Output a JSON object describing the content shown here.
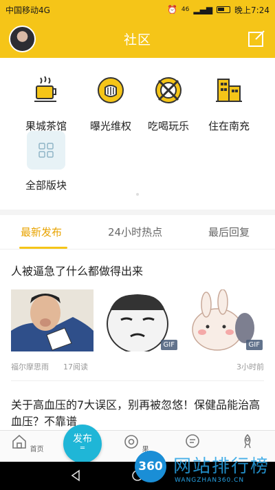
{
  "status_bar": {
    "carrier": "中国移动4G",
    "signal": "46",
    "time": "晚上7:24"
  },
  "header": {
    "title": "社区"
  },
  "categories": [
    {
      "label": "果城茶馆",
      "icon": "tea-cup-icon"
    },
    {
      "label": "曝光维权",
      "icon": "fist-icon"
    },
    {
      "label": "吃喝玩乐",
      "icon": "fork-knife-icon"
    },
    {
      "label": "住在南充",
      "icon": "building-icon"
    },
    {
      "label": "全部版块",
      "icon": "grid-icon"
    }
  ],
  "tabs": [
    {
      "label": "最新发布",
      "active": true
    },
    {
      "label": "24小时热点",
      "active": false
    },
    {
      "label": "最后回复",
      "active": false
    }
  ],
  "posts": [
    {
      "title": "人被逼急了什么都做得出来",
      "images": [
        {
          "badge": ""
        },
        {
          "badge": "GIF"
        },
        {
          "badge": "GIF"
        }
      ],
      "author": "福尔摩思雨",
      "reads": "17阅读",
      "time": "3小时前"
    },
    {
      "title": "关于高血压的7大误区，别再被忽悠！保健品能治高血压？不靠谱"
    }
  ],
  "bottom_nav": {
    "publish_label": "发布",
    "items": [
      {
        "label": "首页",
        "icon": "home-icon"
      },
      {
        "label": "果",
        "icon": "eye-icon"
      },
      {
        "label": "",
        "icon": "chat-icon"
      },
      {
        "label": "",
        "icon": "rocket-icon"
      }
    ]
  },
  "watermark": {
    "logo": "360",
    "text": "网站排行榜",
    "sub": "WANGZHAN360.CN"
  },
  "colors": {
    "accent": "#f5c518",
    "active_tab": "#e8a300",
    "publish": "#1fb6d7"
  }
}
